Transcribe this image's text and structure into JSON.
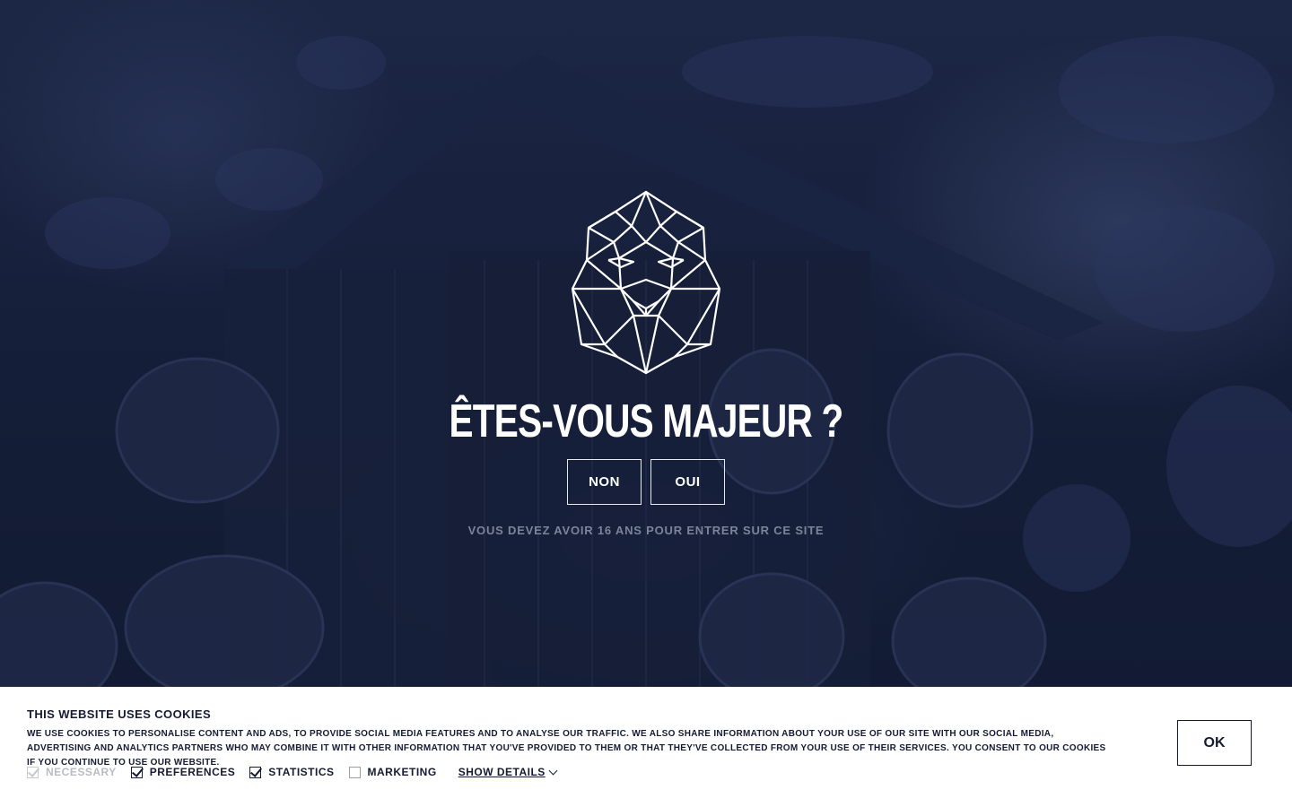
{
  "age_gate": {
    "logo_icon": "lion-head-icon",
    "title": "ÊTES-VOUS MAJEUR ?",
    "no_label": "NON",
    "yes_label": "OUI",
    "note": "VOUS DEVEZ AVOIR 16 ANS POUR ENTRER SUR CE SITE"
  },
  "cookie_banner": {
    "title": "THIS WEBSITE USES COOKIES",
    "text": "WE USE COOKIES TO PERSONALISE CONTENT AND ADS, TO PROVIDE SOCIAL MEDIA FEATURES AND TO ANALYSE OUR TRAFFIC. WE ALSO SHARE INFORMATION ABOUT YOUR USE OF OUR SITE WITH OUR SOCIAL MEDIA, ADVERTISING AND ANALYTICS PARTNERS WHO MAY COMBINE IT WITH OTHER INFORMATION THAT YOU'VE PROVIDED TO THEM OR THAT THEY'VE COLLECTED FROM YOUR USE OF THEIR SERVICES. YOU CONSENT TO OUR COOKIES IF YOU CONTINUE TO USE OUR WEBSITE.",
    "options": {
      "necessary": {
        "label": "NECESSARY",
        "checked": true,
        "disabled": true
      },
      "preferences": {
        "label": "PREFERENCES",
        "checked": true
      },
      "statistics": {
        "label": "STATISTICS",
        "checked": true
      },
      "marketing": {
        "label": "MARKETING",
        "checked": false
      }
    },
    "show_details_label": "SHOW DETAILS",
    "ok_label": "OK"
  },
  "colors": {
    "overlay": "#121a33",
    "text_light": "#ffffff",
    "note_gray": "#7d849a",
    "banner_bg": "#ffffff",
    "banner_text": "#141b33"
  }
}
